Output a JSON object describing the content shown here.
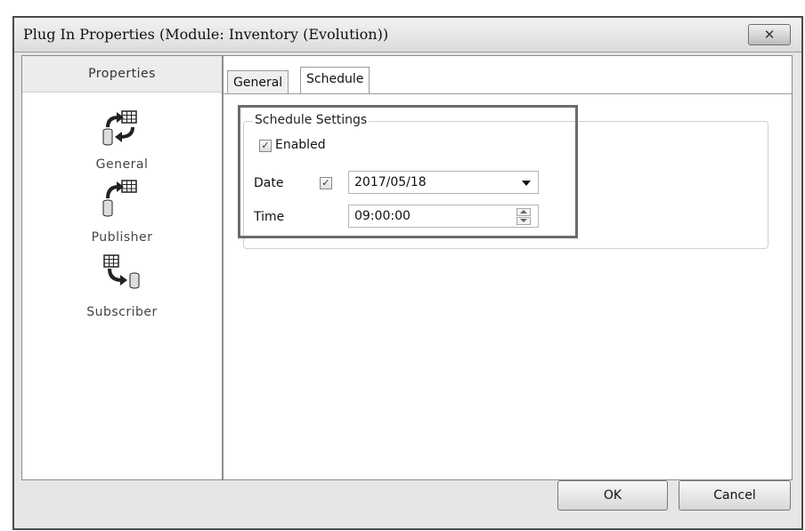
{
  "window": {
    "title": "Plug In Properties (Module: Inventory (Evolution))",
    "close_icon": "close-icon"
  },
  "sidebar": {
    "header": "Properties",
    "items": [
      {
        "label": "General",
        "icon": "sync-database-icon"
      },
      {
        "label": "Publisher",
        "icon": "publish-database-icon"
      },
      {
        "label": "Subscriber",
        "icon": "subscribe-database-icon"
      }
    ]
  },
  "tabs": [
    {
      "label": "General",
      "active": false
    },
    {
      "label": "Schedule",
      "active": true
    }
  ],
  "schedule": {
    "group_title": "Schedule Settings",
    "enabled_label": "Enabled",
    "enabled_checked": true,
    "date_label": "Date",
    "date_checked": true,
    "date_value": "2017/05/18",
    "time_label": "Time",
    "time_value": "09:00:00"
  },
  "footer": {
    "ok_label": "OK",
    "cancel_label": "Cancel"
  },
  "colors": {
    "highlight_border": "#6b6b6b",
    "window_background": "#e6e6e6"
  }
}
